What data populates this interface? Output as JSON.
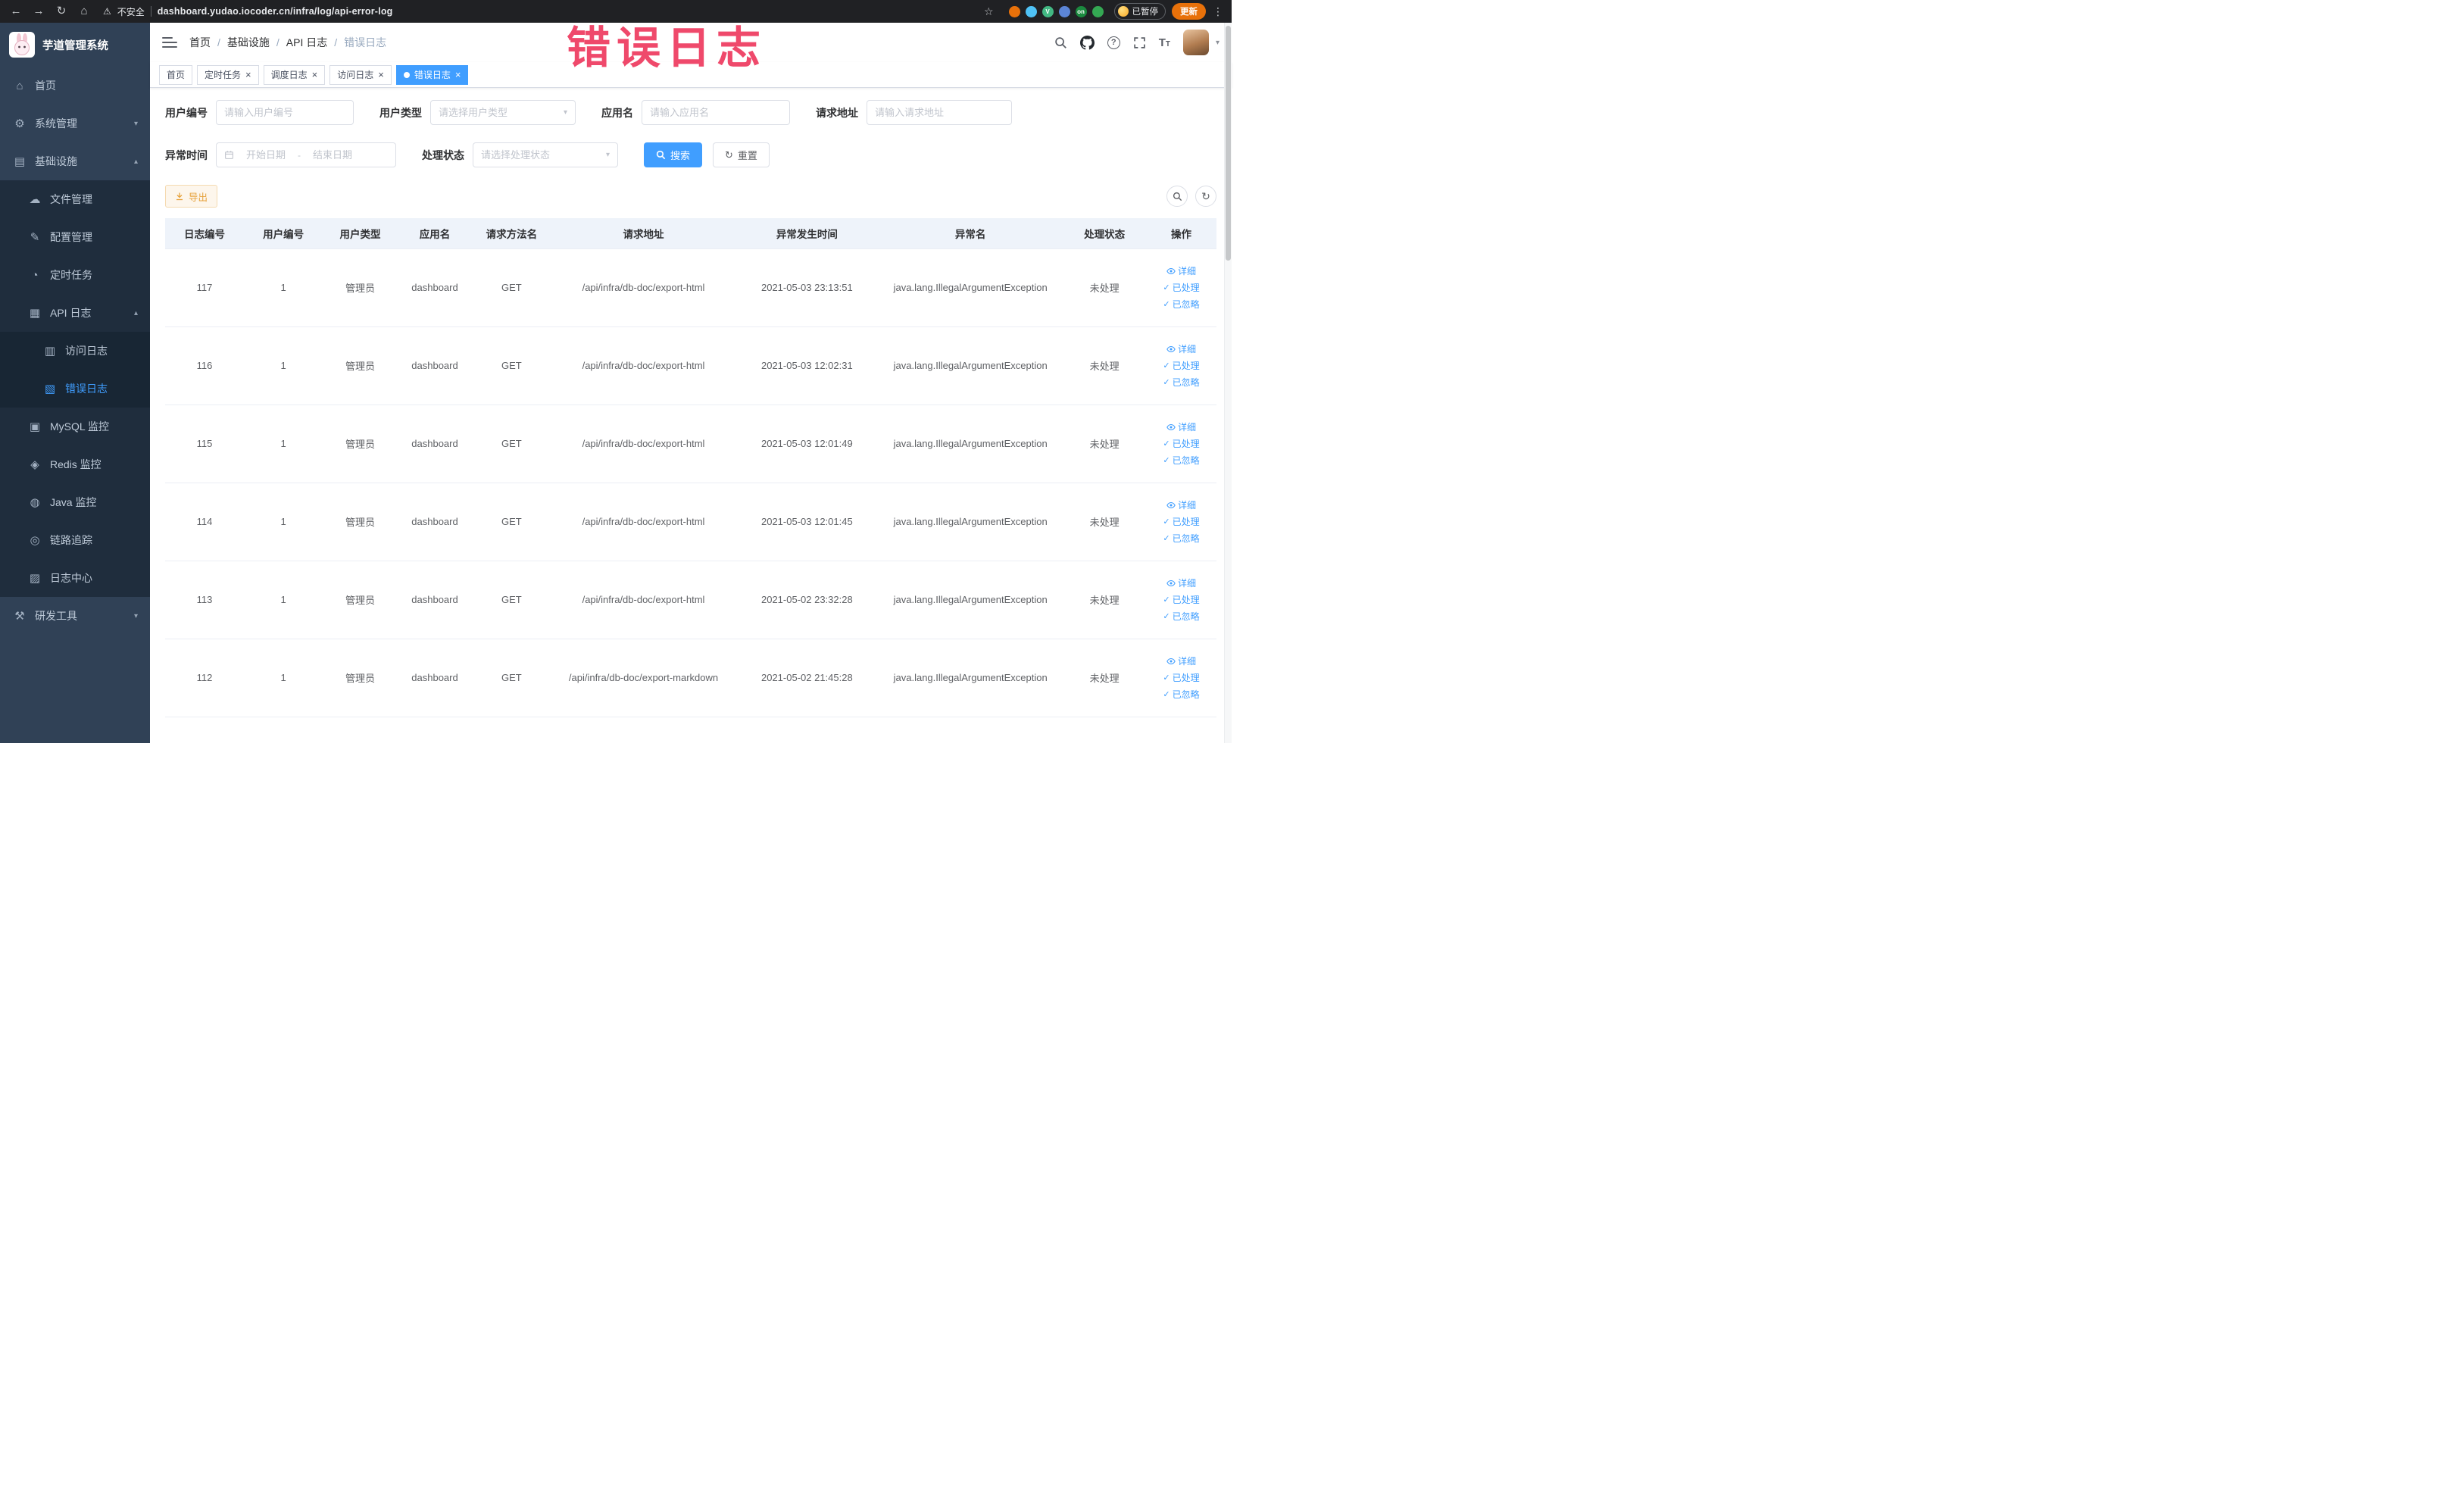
{
  "theme": {
    "accent": "#409eff",
    "sidebar-bg": "#304156",
    "submenu-bg": "#1f2d3d",
    "warning": "#e6a23c",
    "watermark-color": "#ee3a5f"
  },
  "browser": {
    "security_label": "不安全",
    "url": "dashboard.yudao.iocoder.cn/infra/log/api-error-log",
    "profile_badge": "已暂停",
    "update_label": "更新",
    "extensions": [
      {
        "name": "extension-icon-orange",
        "color": "#e8710a"
      },
      {
        "name": "extension-icon-water",
        "color": "#4fc3f7"
      },
      {
        "name": "extension-icon-vue",
        "color": "#42b883",
        "glyph": "V"
      },
      {
        "name": "extension-icon-blue",
        "color": "#5c85d6"
      },
      {
        "name": "extension-icon-on",
        "color": "#1b8a3f",
        "glyph": "on"
      },
      {
        "name": "extension-icon-green",
        "color": "#34a853"
      }
    ]
  },
  "sidebar": {
    "logo_title": "芋道管理系统",
    "items": [
      {
        "label": "首页",
        "icon": "home-icon",
        "glyph": "⌂",
        "level": 0
      },
      {
        "label": "系统管理",
        "icon": "gear-icon",
        "glyph": "⚙",
        "level": 0,
        "arrow": "down"
      },
      {
        "label": "基础设施",
        "icon": "infrastructure-icon",
        "glyph": "▤",
        "level": 0,
        "arrow": "up"
      },
      {
        "label": "文件管理",
        "icon": "file-manage-icon",
        "glyph": "☁",
        "level": 1
      },
      {
        "label": "配置管理",
        "icon": "config-manage-icon",
        "glyph": "✎",
        "level": 1
      },
      {
        "label": "定时任务",
        "icon": "schedule-task-icon",
        "glyph": "◔",
        "level": 1
      },
      {
        "label": "API 日志",
        "icon": "api-log-icon",
        "glyph": "▦",
        "level": 1,
        "arrow": "up"
      },
      {
        "label": "访问日志",
        "icon": "access-log-icon",
        "glyph": "▥",
        "level": 2
      },
      {
        "label": "错误日志",
        "icon": "error-log-icon",
        "glyph": "▧",
        "level": 2,
        "active": true
      },
      {
        "label": "MySQL 监控",
        "icon": "mysql-monitor-icon",
        "glyph": "▣",
        "level": 1
      },
      {
        "label": "Redis 监控",
        "icon": "redis-monitor-icon",
        "glyph": "◈",
        "level": 1
      },
      {
        "label": "Java 监控",
        "icon": "java-monitor-icon",
        "glyph": "◍",
        "level": 1
      },
      {
        "label": "链路追踪",
        "icon": "trace-icon",
        "glyph": "◎",
        "level": 1
      },
      {
        "label": "日志中心",
        "icon": "log-center-icon",
        "glyph": "▨",
        "level": 1
      },
      {
        "label": "研发工具",
        "icon": "devtools-icon",
        "glyph": "⚒",
        "level": 0,
        "arrow": "down"
      }
    ]
  },
  "header": {
    "breadcrumb": [
      "首页",
      "基础设施",
      "API 日志",
      "错误日志"
    ]
  },
  "tabs": [
    {
      "label": "首页"
    },
    {
      "label": "定时任务",
      "closable": true
    },
    {
      "label": "调度日志",
      "closable": true
    },
    {
      "label": "访问日志",
      "closable": true
    },
    {
      "label": "错误日志",
      "closable": true,
      "active": true
    }
  ],
  "watermark": "错误日志",
  "filters": {
    "user_id_label": "用户编号",
    "user_id_placeholder": "请输入用户编号",
    "user_type_label": "用户类型",
    "user_type_placeholder": "请选择用户类型",
    "app_name_label": "应用名",
    "app_name_placeholder": "请输入应用名",
    "request_url_label": "请求地址",
    "request_url_placeholder": "请输入请求地址",
    "exception_time_label": "异常时间",
    "start_date_placeholder": "开始日期",
    "range_separator": "-",
    "end_date_placeholder": "结束日期",
    "process_status_label": "处理状态",
    "process_status_placeholder": "请选择处理状态",
    "search_label": "搜索",
    "reset_label": "重置"
  },
  "toolbar": {
    "export_label": "导出"
  },
  "table": {
    "columns": [
      "日志编号",
      "用户编号",
      "用户类型",
      "应用名",
      "请求方法名",
      "请求地址",
      "异常发生时间",
      "异常名",
      "处理状态",
      "操作"
    ],
    "actions": {
      "detail": "详细",
      "processed": "已处理",
      "ignored": "已忽略"
    },
    "rows": [
      {
        "id": "117",
        "user_id": "1",
        "user_type": "管理员",
        "app": "dashboard",
        "method": "GET",
        "url": "/api/infra/db-doc/export-html",
        "time": "2021-05-03 23:13:51",
        "exception": "java.lang.IllegalArgumentException",
        "status": "未处理"
      },
      {
        "id": "116",
        "user_id": "1",
        "user_type": "管理员",
        "app": "dashboard",
        "method": "GET",
        "url": "/api/infra/db-doc/export-html",
        "time": "2021-05-03 12:02:31",
        "exception": "java.lang.IllegalArgumentException",
        "status": "未处理"
      },
      {
        "id": "115",
        "user_id": "1",
        "user_type": "管理员",
        "app": "dashboard",
        "method": "GET",
        "url": "/api/infra/db-doc/export-html",
        "time": "2021-05-03 12:01:49",
        "exception": "java.lang.IllegalArgumentException",
        "status": "未处理"
      },
      {
        "id": "114",
        "user_id": "1",
        "user_type": "管理员",
        "app": "dashboard",
        "method": "GET",
        "url": "/api/infra/db-doc/export-html",
        "time": "2021-05-03 12:01:45",
        "exception": "java.lang.IllegalArgumentException",
        "status": "未处理"
      },
      {
        "id": "113",
        "user_id": "1",
        "user_type": "管理员",
        "app": "dashboard",
        "method": "GET",
        "url": "/api/infra/db-doc/export-html",
        "time": "2021-05-02 23:32:28",
        "exception": "java.lang.IllegalArgumentException",
        "status": "未处理"
      },
      {
        "id": "112",
        "user_id": "1",
        "user_type": "管理员",
        "app": "dashboard",
        "method": "GET",
        "url": "/api/infra/db-doc/export-markdown",
        "time": "2021-05-02 21:45:28",
        "exception": "java.lang.IllegalArgumentException",
        "status": "未处理"
      }
    ]
  }
}
